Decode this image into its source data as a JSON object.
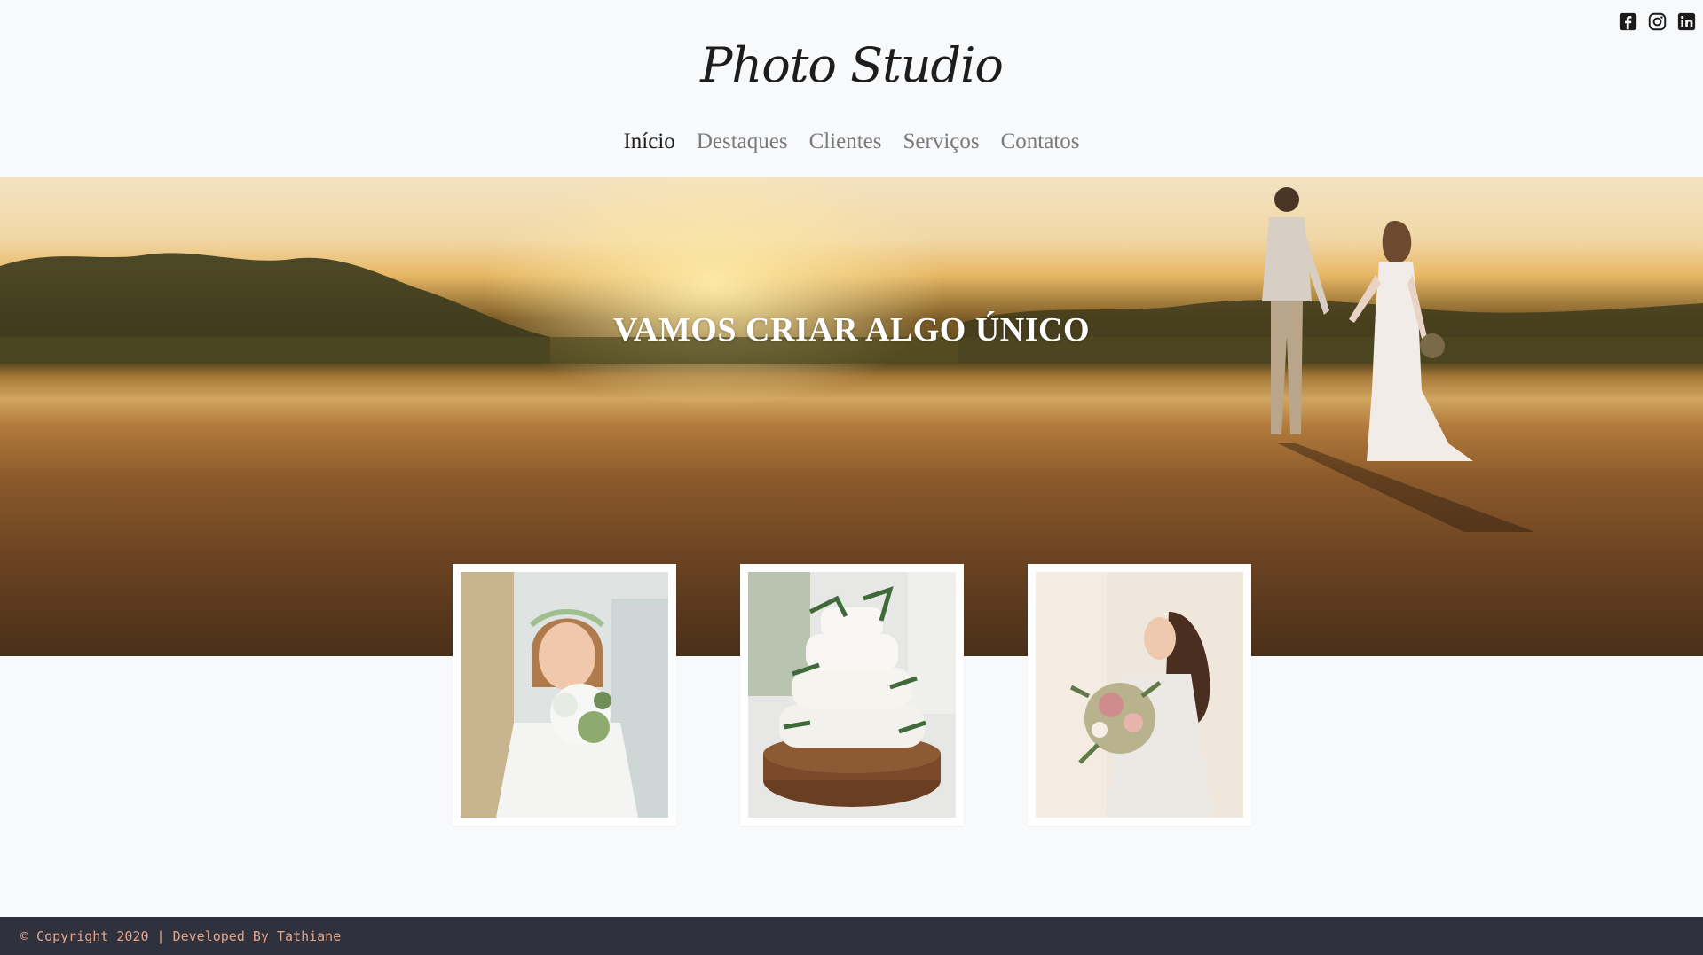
{
  "header": {
    "logo": "Photo Studio",
    "social": [
      {
        "icon": "facebook-icon"
      },
      {
        "icon": "instagram-icon"
      },
      {
        "icon": "linkedin-icon"
      }
    ],
    "nav": [
      {
        "label": "Início",
        "active": true
      },
      {
        "label": "Destaques",
        "active": false
      },
      {
        "label": "Clientes",
        "active": false
      },
      {
        "label": "Serviços",
        "active": false
      },
      {
        "label": "Contatos",
        "active": false
      }
    ]
  },
  "hero": {
    "title": "VAMOS CRIAR ALGO ÚNICO"
  },
  "gallery": [
    {
      "icon": "bride-with-bouquet-photo"
    },
    {
      "icon": "wedding-cake-photo"
    },
    {
      "icon": "bride-holding-flowers-photo"
    }
  ],
  "footer": {
    "text": "© Copyright 2020 | Developed By Tathiane"
  },
  "colors": {
    "background": "#f8f9fb",
    "footer_bg": "#2f323d",
    "footer_text": "#e3a48c",
    "nav_active": "#1b1b1b",
    "nav_inactive": "#7a7a7a"
  }
}
